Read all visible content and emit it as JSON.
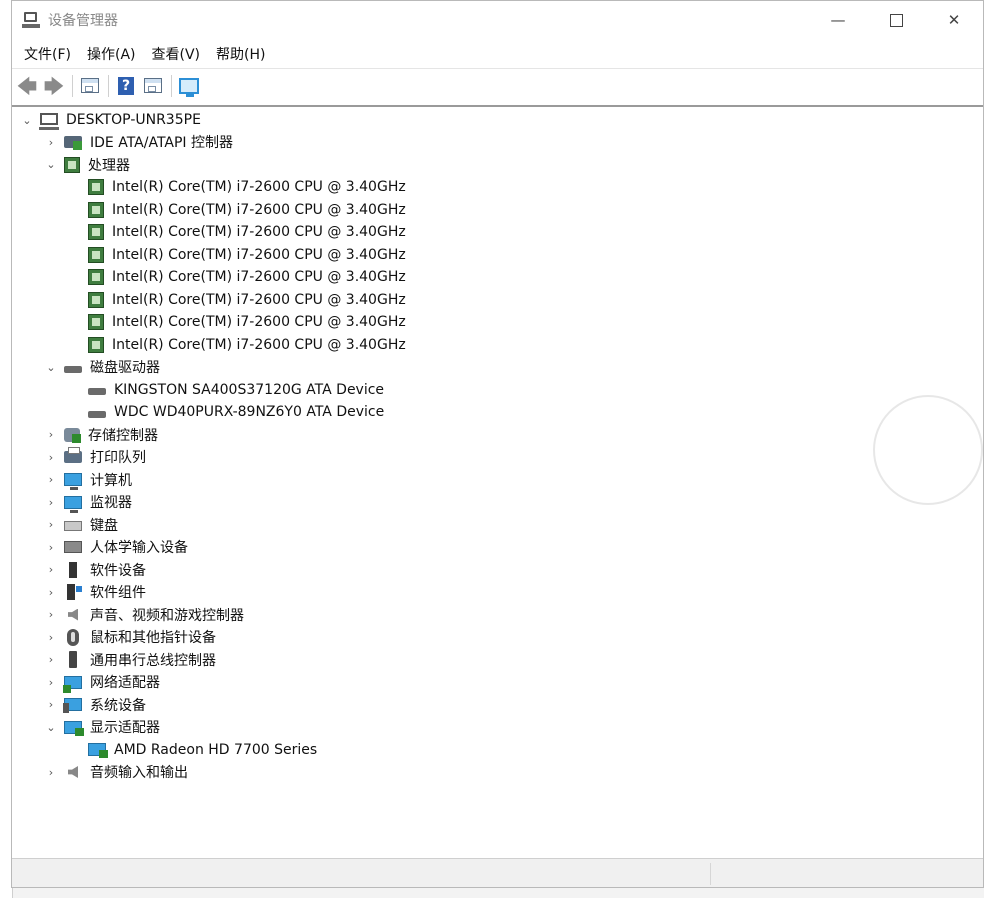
{
  "window": {
    "title": "设备管理器",
    "controls": {
      "minimize": "—",
      "close": "✕"
    }
  },
  "menubar": [
    {
      "label": "文件(F)"
    },
    {
      "label": "操作(A)"
    },
    {
      "label": "查看(V)"
    },
    {
      "label": "帮助(H)"
    }
  ],
  "toolbar": {
    "back": "🡄",
    "forward": "🡆",
    "help": "?"
  },
  "tree": {
    "root": "DESKTOP-UNR35PE",
    "expanded_marker": "⌄",
    "collapsed_marker": "›",
    "nodes": [
      {
        "label": "IDE ATA/ATAPI 控制器",
        "icon": "ide-controller-icon",
        "expanded": false
      },
      {
        "label": "处理器",
        "icon": "processor-icon",
        "expanded": true
      },
      {
        "label": "Intel(R) Core(TM) i7-2600 CPU @ 3.40GHz",
        "icon": "processor-icon",
        "child": true
      },
      {
        "label": "Intel(R) Core(TM) i7-2600 CPU @ 3.40GHz",
        "icon": "processor-icon",
        "child": true
      },
      {
        "label": "Intel(R) Core(TM) i7-2600 CPU @ 3.40GHz",
        "icon": "processor-icon",
        "child": true
      },
      {
        "label": "Intel(R) Core(TM) i7-2600 CPU @ 3.40GHz",
        "icon": "processor-icon",
        "child": true
      },
      {
        "label": "Intel(R) Core(TM) i7-2600 CPU @ 3.40GHz",
        "icon": "processor-icon",
        "child": true
      },
      {
        "label": "Intel(R) Core(TM) i7-2600 CPU @ 3.40GHz",
        "icon": "processor-icon",
        "child": true
      },
      {
        "label": "Intel(R) Core(TM) i7-2600 CPU @ 3.40GHz",
        "icon": "processor-icon",
        "child": true
      },
      {
        "label": "Intel(R) Core(TM) i7-2600 CPU @ 3.40GHz",
        "icon": "processor-icon",
        "child": true
      },
      {
        "label": "磁盘驱动器",
        "icon": "disk-drive-icon",
        "expanded": true
      },
      {
        "label": "KINGSTON SA400S37120G ATA Device",
        "icon": "disk-drive-icon",
        "child": true
      },
      {
        "label": "WDC WD40PURX-89NZ6Y0 ATA Device",
        "icon": "disk-drive-icon",
        "child": true
      },
      {
        "label": "存储控制器",
        "icon": "storage-controller-icon",
        "expanded": false
      },
      {
        "label": "打印队列",
        "icon": "print-queue-icon",
        "expanded": false
      },
      {
        "label": "计算机",
        "icon": "computer-icon",
        "expanded": false
      },
      {
        "label": "监视器",
        "icon": "monitor-icon",
        "expanded": false
      },
      {
        "label": "键盘",
        "icon": "keyboard-icon",
        "expanded": false
      },
      {
        "label": "人体学输入设备",
        "icon": "hid-icon",
        "expanded": false
      },
      {
        "label": "软件设备",
        "icon": "software-device-icon",
        "expanded": false
      },
      {
        "label": "软件组件",
        "icon": "software-component-icon",
        "expanded": false
      },
      {
        "label": "声音、视频和游戏控制器",
        "icon": "speaker-icon",
        "expanded": false
      },
      {
        "label": "鼠标和其他指针设备",
        "icon": "mouse-icon",
        "expanded": false
      },
      {
        "label": "通用串行总线控制器",
        "icon": "usb-icon",
        "expanded": false
      },
      {
        "label": "网络适配器",
        "icon": "network-adapter-icon",
        "expanded": false
      },
      {
        "label": "系统设备",
        "icon": "system-device-icon",
        "expanded": false
      },
      {
        "label": "显示适配器",
        "icon": "display-adapter-icon",
        "expanded": true
      },
      {
        "label": "AMD Radeon HD 7700 Series",
        "icon": "display-adapter-icon",
        "child": true
      },
      {
        "label": "音频输入和输出",
        "icon": "speaker-icon",
        "expanded": false
      }
    ]
  },
  "colors": {
    "processor": "#3f7d3f",
    "monitor": "#3aa0e0",
    "title_text": "#888888"
  }
}
